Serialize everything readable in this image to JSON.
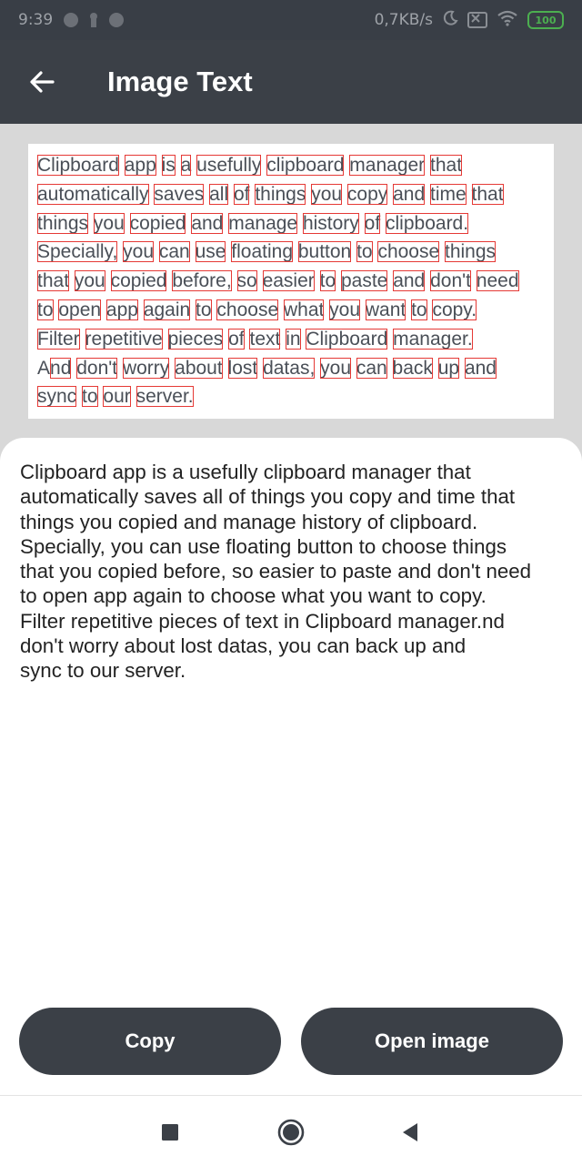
{
  "status_bar": {
    "time": "9:39",
    "speed": "0,7KB/s",
    "battery": "100"
  },
  "app_bar": {
    "title": "Image Text"
  },
  "image": {
    "lines": [
      [
        "Clipboard",
        "app",
        "is",
        "a",
        "usefully",
        "clipboard",
        "manager",
        "that"
      ],
      [
        "automatically",
        "saves",
        "all",
        "of",
        "things",
        "you",
        "copy",
        "and",
        "time",
        "that"
      ],
      [
        "things",
        "you",
        "copied",
        "and",
        "manage",
        "history",
        "of",
        "clipboard."
      ],
      [
        "Specially,",
        "you",
        "can",
        "use",
        "floating",
        "button",
        "to",
        "choose",
        "things"
      ],
      [
        "that",
        "you",
        "copied",
        "before,",
        "so",
        "easier",
        "to",
        "paste",
        "and",
        "don't",
        "need"
      ],
      [
        "to",
        "open",
        "app",
        "again",
        "to",
        "choose",
        "what",
        "you",
        "want",
        "to",
        "copy."
      ],
      [
        "Filter",
        "repetitive",
        "pieces",
        "of",
        "text",
        "in",
        "Clipboard",
        "manager."
      ],
      [
        "A",
        "nd",
        "don't",
        "worry",
        "about",
        "lost",
        "datas,",
        "you",
        "can",
        "back",
        "up",
        "and"
      ],
      [
        "sync",
        "to",
        "our",
        "server."
      ]
    ]
  },
  "result": {
    "text": "Clipboard app is a usefully clipboard manager that\nautomatically saves all of things you copy and time that\nthings you copied and manage history of clipboard.\nSpecially, you can use floating button to choose things\nthat you copied before, so easier to paste and don't need\nto open app again to choose what you want to copy.\nFilter repetitive pieces of text in Clipboard manager.nd\ndon't worry about lost datas, you can back up and\nsync to our server."
  },
  "actions": {
    "copy_label": "Copy",
    "open_image_label": "Open image"
  },
  "icons": {
    "back": "arrow-left-icon",
    "nav_recents": "square-icon",
    "nav_home": "circle-icon",
    "nav_back": "triangle-left-icon"
  },
  "colors": {
    "app_bar": "#3b4047",
    "button": "#3b4047",
    "highlight": "#e53935"
  }
}
